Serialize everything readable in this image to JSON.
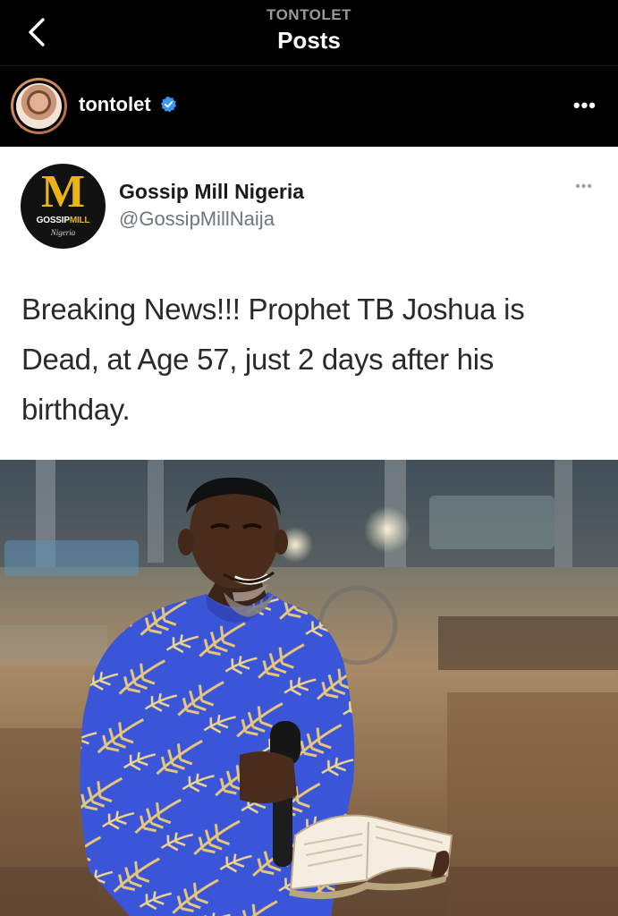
{
  "nav": {
    "account": "TONTOLET",
    "title": "Posts"
  },
  "post": {
    "username": "tontolet",
    "verified": true,
    "more_icon": "more-horizontal-icon"
  },
  "tweet": {
    "display_name": "Gossip Mill Nigeria",
    "handle": "@GossipMillNaija",
    "logo": {
      "letter": "M",
      "brand_part1": "GOSSIP",
      "brand_part2": "MILL",
      "tagline": "Nigeria"
    },
    "text": "Breaking News!!! Prophet TB Joshua is Dead, at Age 57, just 2 days after his birthday."
  },
  "colors": {
    "background": "#000000",
    "card": "#ffffff",
    "verified_blue": "#3897f0",
    "logo_gold": "#e9b416",
    "shirt_blue": "#3b55d9"
  }
}
